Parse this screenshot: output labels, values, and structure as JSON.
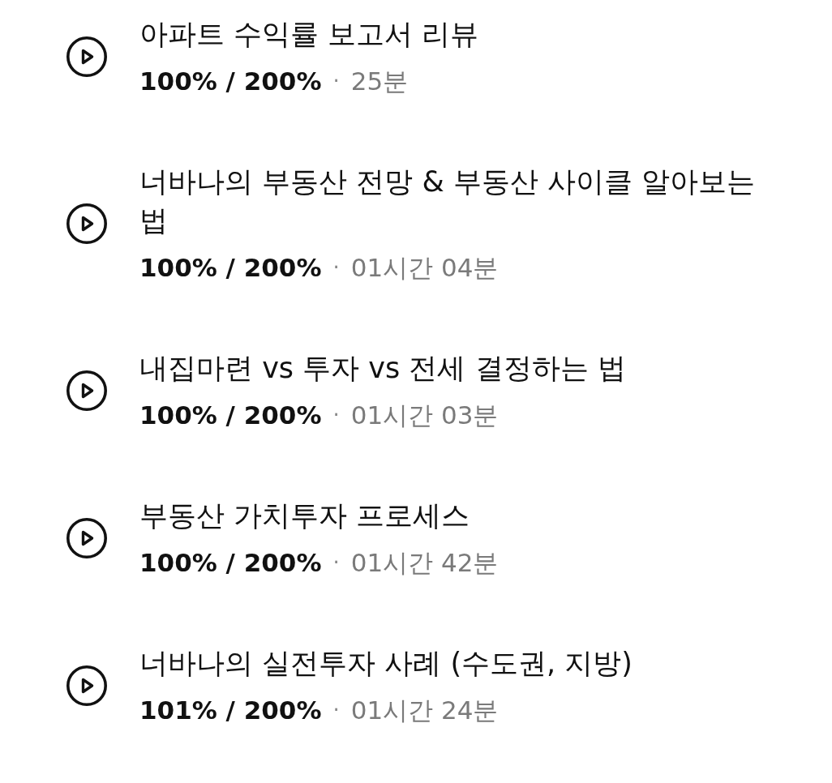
{
  "lectures": [
    {
      "title": "아파트 수익률 보고서 리뷰",
      "progress": "100% / 200%",
      "separator": "·",
      "duration": "25분"
    },
    {
      "title": "너바나의 부동산 전망 & 부동산 사이클 알아보는 법",
      "progress": "100% / 200%",
      "separator": "·",
      "duration": "01시간 04분"
    },
    {
      "title": "내집마련 vs 투자 vs 전세 결정하는 법",
      "progress": "100% / 200%",
      "separator": "·",
      "duration": "01시간 03분"
    },
    {
      "title": "부동산 가치투자 프로세스",
      "progress": "100% / 200%",
      "separator": "·",
      "duration": "01시간 42분"
    },
    {
      "title": "너바나의 실전투자 사례 (수도권, 지방)",
      "progress": "101% / 200%",
      "separator": "·",
      "duration": "01시간 24분"
    }
  ]
}
